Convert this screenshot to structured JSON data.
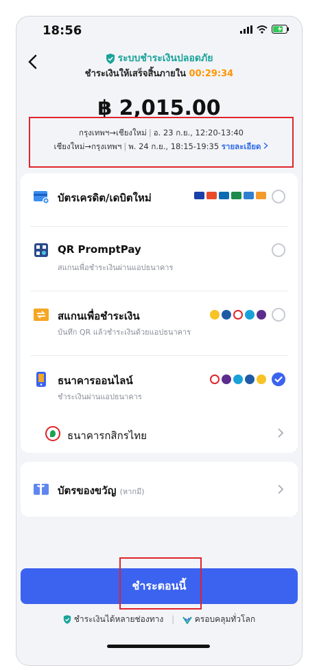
{
  "status_bar": {
    "time": "18:56"
  },
  "header": {
    "secure_label": "ระบบชำระเงินปลอดภัย",
    "deadline_prefix": "ชำระเงินให้เสร็จสิ้นภายใน",
    "countdown": "00:29:34"
  },
  "amount": "฿ 2,015.00",
  "routes": [
    {
      "route": "กรุงเทพฯ→เชียงใหม่",
      "when": "อ. 23 ก.ย., 12:20-13:40"
    },
    {
      "route": "เชียงใหม่→กรุงเทพฯ",
      "when": "พ. 24 ก.ย., 18:15-19:35"
    }
  ],
  "details_label": "รายละเอียด",
  "payment_options": {
    "card": {
      "title": "บัตรเครดิต/เดบิตใหม่",
      "selected": false
    },
    "promptpay": {
      "title": "QR PromptPay",
      "subtitle": "สแกนเพื่อชำระเงินผ่านแอปธนาคาร",
      "selected": false
    },
    "scan": {
      "title": "สแกนเพื่อชำระเงิน",
      "subtitle": "บันทึก QR แล้วชำระเงินด้วยแอปธนาคาร",
      "selected": false
    },
    "online_banking": {
      "title": "ธนาคารออนไลน์",
      "subtitle": "ชำระเงินผ่านแอปธนาคาร",
      "selected": true,
      "bank": "ธนาคารกสิกรไทย"
    }
  },
  "gift_card": {
    "title": "บัตรของขวัญ",
    "hint": "(หากมี)"
  },
  "pay_button": "ชำระตอนนี้",
  "footer": {
    "left": "ชำระเงินได้หลายช่องทาง",
    "right": "ครอบคลุมทั่วโลก"
  },
  "colors": {
    "accent": "#3b63f0",
    "secure": "#1aa39a",
    "countdown": "#ff9500",
    "highlight_box": "#e0232a"
  }
}
